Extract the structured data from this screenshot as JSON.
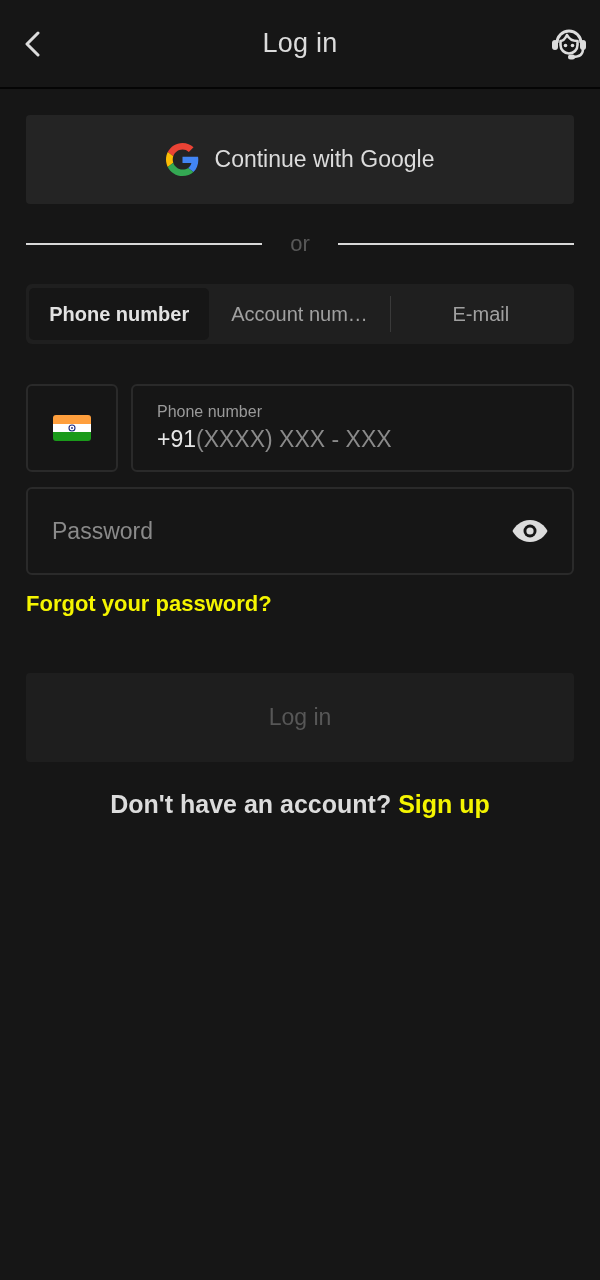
{
  "header": {
    "title": "Log in"
  },
  "google_button": {
    "label": "Continue with Google"
  },
  "divider": {
    "label": "or"
  },
  "tabs": [
    {
      "label": "Phone number",
      "selected": true
    },
    {
      "label": "Account num…",
      "selected": false
    },
    {
      "label": "E-mail",
      "selected": false
    }
  ],
  "phone": {
    "label": "Phone number",
    "prefix": "+91",
    "placeholder": "(XXXX) XXX - XXX"
  },
  "password": {
    "placeholder": "Password"
  },
  "forgot_link": "Forgot your password?",
  "login_button": {
    "label": "Log in",
    "disabled": true
  },
  "signup": {
    "prompt": "Don't have an account?",
    "link": "Sign up"
  }
}
